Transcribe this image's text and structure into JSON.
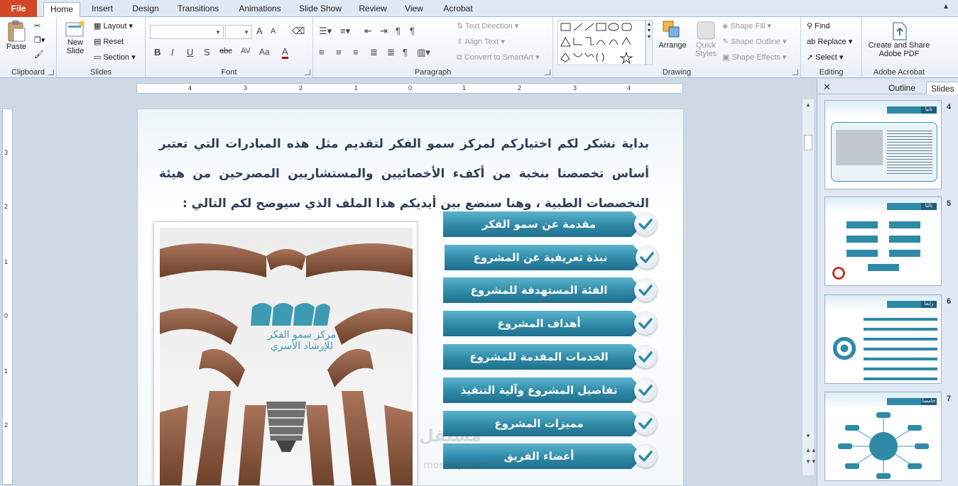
{
  "tabs": [
    "File",
    "Home",
    "Insert",
    "Design",
    "Transitions",
    "Animations",
    "Slide Show",
    "Review",
    "View",
    "Acrobat"
  ],
  "active_tab": "Home",
  "ribbon": {
    "clipboard": {
      "label": "Clipboard",
      "paste": "Paste"
    },
    "slides": {
      "label": "Slides",
      "new_slide_1": "New",
      "new_slide_2": "Slide",
      "layout": "Layout",
      "reset": "Reset",
      "section": "Section"
    },
    "font": {
      "label": "Font",
      "grow": "A",
      "shrink": "A",
      "bold": "B",
      "italic": "I",
      "underline": "U",
      "shadow": "S",
      "strike": "abc",
      "spacing": "AV",
      "case": "Aa",
      "color": "A"
    },
    "paragraph": {
      "label": "Paragraph",
      "text_direction": "Text Direction",
      "align_text": "Align Text",
      "convert_smartart": "Convert to SmartArt"
    },
    "drawing": {
      "label": "Drawing",
      "arrange": "Arrange",
      "quick_styles_1": "Quick",
      "quick_styles_2": "Styles",
      "shape_fill": "Shape Fill",
      "shape_outline": "Shape Outline",
      "shape_effects": "Shape Effects"
    },
    "editing": {
      "label": "Editing",
      "find": "Find",
      "replace": "Replace",
      "select": "Select"
    },
    "acrobat": {
      "label": "Adobe Acrobat",
      "create_1": "Create and Share",
      "create_2": "Adobe PDF"
    }
  },
  "ruler_h": [
    "4",
    "3",
    "2",
    "1",
    "0",
    "1",
    "2",
    "3",
    "4"
  ],
  "ruler_v": [
    "3",
    "2",
    "1",
    "0",
    "1",
    "2"
  ],
  "slide": {
    "intro": "بداية نشكر لكم اختياركم لمركز سمو الفكر لتقديم مثل هذه المبادرات التي تعتبر أساس تخصصنا بنخبة من أكفء الأخصائيين والمستشاريين المصرحين من هيئة التخصصات الطبية ، وهنا سنضع بين أيديكم هذا الملف الذي سيوضح لكم التالي :",
    "logo_line1": "مركز سمو الفكر",
    "logo_line2": "للإرشاد الأسري",
    "items": [
      "مقدمة عن سمو الفكر",
      "نبذة تعريفية عن المشروع",
      "الفئة المستهدفة للمشروع",
      "أهداف المشروع",
      "الخدمات المقدمة للمشروع",
      "تفاصيل المشروع وآلية التنفيذ",
      "مميزات المشروع",
      "أعضاء الفريق"
    ]
  },
  "pane": {
    "outline_tab": "Outline",
    "slides_tab": "Slides",
    "thumbnails": [
      {
        "num": "4",
        "title": "ثانياً"
      },
      {
        "num": "5",
        "title": "ثالثاً"
      },
      {
        "num": "6",
        "title": "رابعاً"
      },
      {
        "num": "7",
        "title": "خامساً"
      }
    ]
  },
  "watermark": {
    "arabic": "مستقل",
    "latin": "mostaql.com"
  },
  "colors": {
    "accent": "#2f8aa8",
    "file_tab": "#d24726",
    "ribbon_bg": "#e9eff7"
  }
}
